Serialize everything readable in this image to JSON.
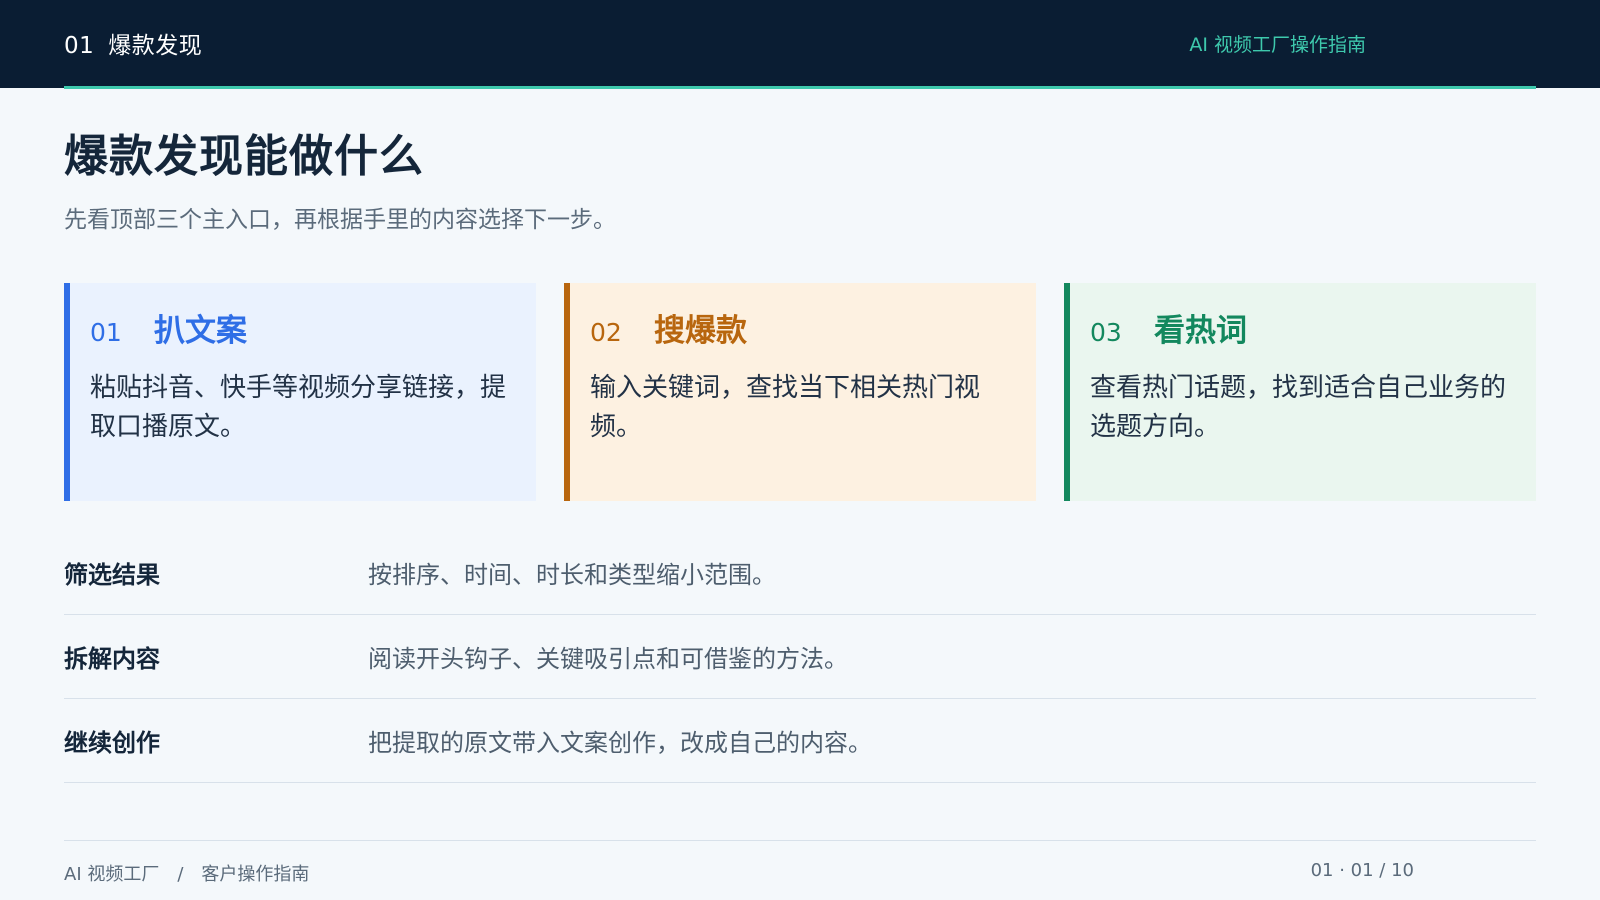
{
  "header": {
    "section_number": "01",
    "section_name": "爆款发现",
    "guide_title": "AI 视频工厂操作指南"
  },
  "main": {
    "title": "爆款发现能做什么",
    "subtitle": "先看顶部三个主入口，再根据手里的内容选择下一步。"
  },
  "cards": [
    {
      "number": "01",
      "title": "扒文案",
      "description": "粘贴抖音、快手等视频分享链接，提取口播原文。"
    },
    {
      "number": "02",
      "title": "搜爆款",
      "description": "输入关键词，查找当下相关热门视频。"
    },
    {
      "number": "03",
      "title": "看热词",
      "description": "查看热门话题，找到适合自己业务的选题方向。"
    }
  ],
  "steps": [
    {
      "label": "筛选结果",
      "text": "按排序、时间、时长和类型缩小范围。"
    },
    {
      "label": "拆解内容",
      "text": "阅读开头钩子、关键吸引点和可借鉴的方法。"
    },
    {
      "label": "继续创作",
      "text": "把提取的原文带入文案创作，改成自己的内容。"
    }
  ],
  "footer": {
    "brand": "AI 视频工厂",
    "separator": "/",
    "doc_name": "客户操作指南",
    "page_indicator": "01 · 01 / 10"
  },
  "colors": {
    "header_bg": "#0a1d33",
    "accent": "#3ec9ad",
    "card_blue": "#2f6ee6",
    "card_amber": "#b8660e",
    "card_green": "#13885e"
  }
}
